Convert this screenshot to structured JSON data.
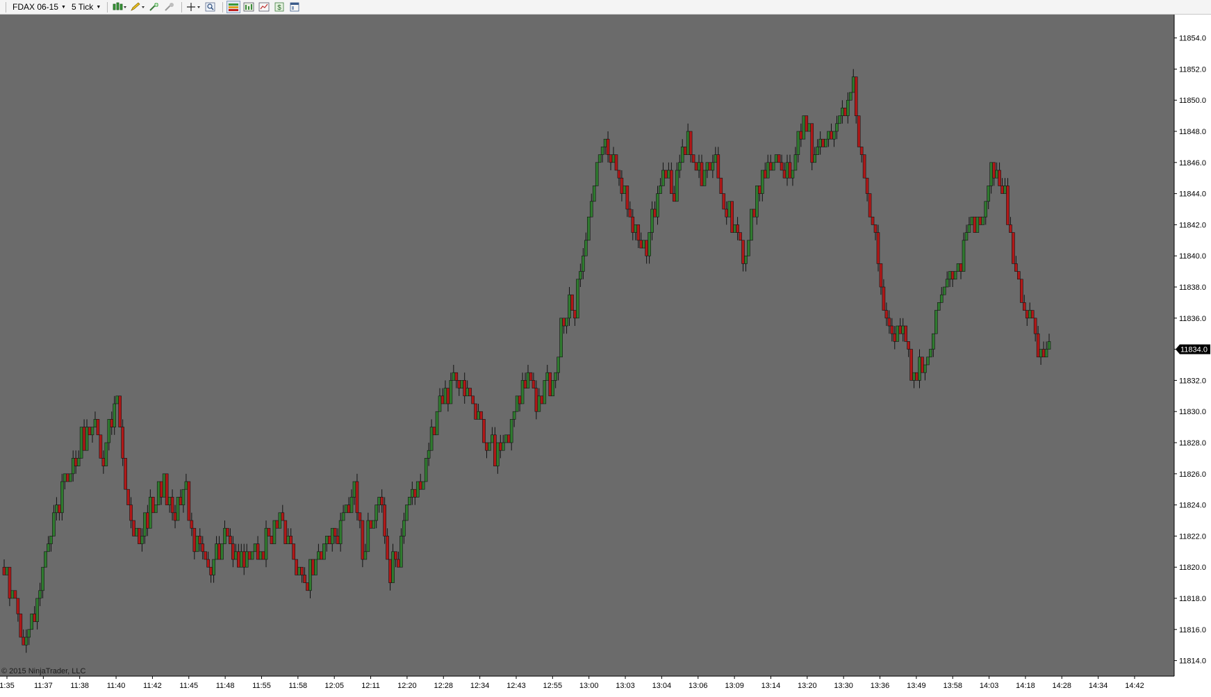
{
  "toolbar": {
    "instrument": "FDAX 06-15",
    "interval": "5 Tick",
    "icons": [
      "candlestick-icon",
      "pencil-icon",
      "add-indicator-icon",
      "add-strategy-icon",
      "crosshair-icon",
      "zoom-icon",
      "chart-trader-icon",
      "data-box-icon",
      "chart-properties-icon",
      "dollar-icon",
      "window-icon"
    ]
  },
  "colors": {
    "background": "#6b6b6b",
    "up_candle": "#2f7a2f",
    "down_candle": "#b01818",
    "wick": "#111111",
    "axis_bg": "#ffffff",
    "price_tag": "#000000"
  },
  "copyright": "© 2015 NinjaTrader, LLC",
  "current_price": "11834.0",
  "chart_data": {
    "type": "candlestick",
    "instrument": "FDAX 06-15",
    "interval": "5 Tick",
    "y_ticks": [
      "11854.0",
      "11852.0",
      "11850.0",
      "11848.0",
      "11846.0",
      "11844.0",
      "11842.0",
      "11840.0",
      "11838.0",
      "11836.0",
      "11834.0",
      "11832.0",
      "11830.0",
      "11828.0",
      "11826.0",
      "11824.0",
      "11822.0",
      "11820.0",
      "11818.0",
      "11816.0",
      "11814.0"
    ],
    "x_ticks": [
      "1:35",
      "11:37",
      "11:38",
      "11:40",
      "11:42",
      "11:45",
      "11:48",
      "11:55",
      "11:58",
      "12:05",
      "12:11",
      "12:20",
      "12:28",
      "12:34",
      "12:43",
      "12:55",
      "13:00",
      "13:03",
      "13:04",
      "13:06",
      "13:09",
      "13:14",
      "13:20",
      "13:30",
      "13:36",
      "13:49",
      "13:58",
      "14:03",
      "14:18",
      "14:28",
      "14:34",
      "14:42"
    ],
    "ylim": [
      11813,
      11855.5
    ],
    "current_price": 11834.0,
    "path": [
      [
        0,
        11820
      ],
      [
        28,
        11815.5
      ],
      [
        50,
        11817.5
      ],
      [
        70,
        11823
      ],
      [
        110,
        11828
      ],
      [
        150,
        11828
      ],
      [
        163,
        11832
      ],
      [
        175,
        11826
      ],
      [
        190,
        11822
      ],
      [
        205,
        11823
      ],
      [
        230,
        11825.5
      ],
      [
        245,
        11823
      ],
      [
        262,
        11825
      ],
      [
        270,
        11822
      ],
      [
        300,
        11820
      ],
      [
        320,
        11822.5
      ],
      [
        345,
        11820
      ],
      [
        375,
        11821.5
      ],
      [
        405,
        11823
      ],
      [
        430,
        11819
      ],
      [
        465,
        11821
      ],
      [
        490,
        11823
      ],
      [
        507,
        11825
      ],
      [
        520,
        11821
      ],
      [
        545,
        11825
      ],
      [
        560,
        11819.5
      ],
      [
        580,
        11823
      ],
      [
        610,
        11826
      ],
      [
        635,
        11831
      ],
      [
        660,
        11832.5
      ],
      [
        680,
        11830
      ],
      [
        712,
        11827
      ],
      [
        740,
        11829.5
      ],
      [
        755,
        11832
      ],
      [
        770,
        11831
      ],
      [
        800,
        11832
      ],
      [
        810,
        11836
      ],
      [
        828,
        11837.5
      ],
      [
        845,
        11842
      ],
      [
        870,
        11847.5
      ],
      [
        895,
        11845
      ],
      [
        915,
        11842
      ],
      [
        930,
        11840
      ],
      [
        955,
        11846
      ],
      [
        970,
        11844
      ],
      [
        990,
        11848
      ],
      [
        1005,
        11845
      ],
      [
        1030,
        11846.5
      ],
      [
        1045,
        11843
      ],
      [
        1060,
        11842
      ],
      [
        1075,
        11840
      ],
      [
        1095,
        11845
      ],
      [
        1120,
        11846
      ],
      [
        1140,
        11845.5
      ],
      [
        1160,
        11849
      ],
      [
        1175,
        11846
      ],
      [
        1195,
        11848
      ],
      [
        1215,
        11848.5
      ],
      [
        1230,
        11851.5
      ],
      [
        1242,
        11847
      ],
      [
        1260,
        11842
      ],
      [
        1275,
        11837
      ],
      [
        1290,
        11834
      ],
      [
        1300,
        11835.5
      ],
      [
        1318,
        11832.5
      ],
      [
        1340,
        11833
      ],
      [
        1360,
        11837.5
      ],
      [
        1380,
        11839
      ],
      [
        1395,
        11841.5
      ],
      [
        1415,
        11842
      ],
      [
        1432,
        11845.5
      ],
      [
        1448,
        11844.5
      ],
      [
        1460,
        11840.5
      ],
      [
        1480,
        11837
      ],
      [
        1495,
        11836
      ],
      [
        1505,
        11833
      ],
      [
        1517,
        11834
      ]
    ]
  }
}
